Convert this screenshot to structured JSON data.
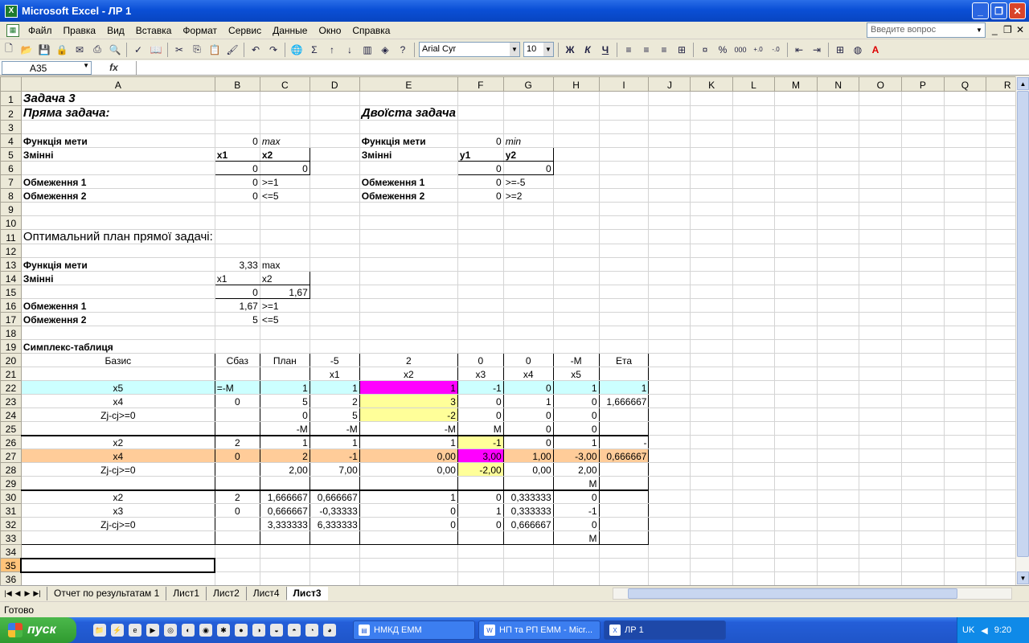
{
  "window": {
    "title": "Microsoft Excel - ЛР 1",
    "app_icon": "X"
  },
  "menu": {
    "items": [
      "Файл",
      "Правка",
      "Вид",
      "Вставка",
      "Формат",
      "Сервис",
      "Данные",
      "Окно",
      "Справка"
    ],
    "help_placeholder": "Введите вопрос"
  },
  "toolbar": {
    "font": "Arial Cyr",
    "size": "10",
    "bold": "Ж",
    "italic": "К",
    "underline": "Ч",
    "percent": "%",
    "thousands": "000"
  },
  "formula": {
    "namebox": "A35",
    "fx": "fx",
    "content": ""
  },
  "columns": [
    "A",
    "B",
    "C",
    "D",
    "E",
    "F",
    "G",
    "H",
    "I",
    "J",
    "K",
    "L",
    "M",
    "N",
    "O",
    "P",
    "Q",
    "R"
  ],
  "cells": {
    "A1": "Задача 3",
    "A2": "Пряма задача:",
    "E2": "Двоїста задача",
    "A4": "Функція мети",
    "B4": "0",
    "C4": "max",
    "E4": "Функція мети",
    "F4": "0",
    "G4": "min",
    "A5": "Змінні",
    "B5": "x1",
    "C5": "x2",
    "E5": "Змінні",
    "F5": "y1",
    "G5": "y2",
    "B6": "0",
    "C6": "0",
    "F6": "0",
    "G6": "0",
    "A7": "Обмеження 1",
    "B7": "0",
    "C7": ">=1",
    "E7": "Обмеження 1",
    "F7": "0",
    "G7": ">=-5",
    "A8": "Обмеження 2",
    "B8": "0",
    "C8": "<=5",
    "E8": "Обмеження 2",
    "F8": "0",
    "G8": ">=2",
    "A11": "Оптимальний план прямої задачі:",
    "A13": "Функція мети",
    "B13": "3,33",
    "C13": "max",
    "A14": "Змінні",
    "B14": "x1",
    "C14": "x2",
    "B15": "0",
    "C15": "1,67",
    "A16": "Обмеження 1",
    "B16": "1,67",
    "C16": ">=1",
    "A17": "Обмеження 2",
    "B17": "5",
    "C17": "<=5",
    "A19": "Симплекс-таблиця",
    "A20": "Базис",
    "B20": "Сбаз",
    "C20": "План",
    "D20": "-5",
    "E20": "2",
    "F20": "0",
    "G20": "0",
    "H20": "-M",
    "I20": "Ета",
    "D21": "x1",
    "E21": "x2",
    "F21": "x3",
    "G21": "x4",
    "H21": "x5",
    "A22": "x5",
    "B22": "=-M",
    "C22": "1",
    "D22": "1",
    "E22": "1",
    "F22": "-1",
    "G22": "0",
    "H22": "1",
    "I22": "1",
    "A23": "x4",
    "B23": "0",
    "C23": "5",
    "D23": "2",
    "E23": "3",
    "F23": "0",
    "G23": "1",
    "H23": "0",
    "I23": "1,666667",
    "A24": "Zj-cj>=0",
    "C24": "0",
    "D24": "5",
    "E24": "-2",
    "F24": "0",
    "G24": "0",
    "H24": "0",
    "C25": "-M",
    "D25": "-M",
    "E25": "-M",
    "F25": "M",
    "G25": "0",
    "H25": "0",
    "A26": "x2",
    "B26": "2",
    "C26": "1",
    "D26": "1",
    "E26": "1",
    "F26": "-1",
    "G26": "0",
    "H26": "1",
    "I26": "-",
    "A27": "x4",
    "B27": "0",
    "C27": "2",
    "D27": "-1",
    "E27": "0,00",
    "F27": "3,00",
    "G27": "1,00",
    "H27": "-3,00",
    "I27": "0,666667",
    "A28": "Zj-cj>=0",
    "C28": "2,00",
    "D28": "7,00",
    "E28": "0,00",
    "F28": "-2,00",
    "G28": "0,00",
    "H28": "2,00",
    "H29": "M",
    "A30": "x2",
    "B30": "2",
    "C30": "1,666667",
    "D30": "0,666667",
    "E30": "1",
    "F30": "0",
    "G30": "0,333333",
    "H30": "0",
    "A31": "x3",
    "B31": "0",
    "C31": "0,666667",
    "D31": "-0,33333",
    "E31": "0",
    "F31": "1",
    "G31": "0,333333",
    "H31": "-1",
    "A32": "Zj-cj>=0",
    "C32": "3,333333",
    "D32": "6,333333",
    "E32": "0",
    "F32": "0",
    "G32": "0,666667",
    "H32": "0",
    "H33": "M"
  },
  "sheets": [
    "Отчет по результатам 1",
    "Лист1",
    "Лист2",
    "Лист4",
    "Лист3"
  ],
  "active_sheet": "Лист3",
  "status": "Готово",
  "taskbar": {
    "start": "пуск",
    "tasks": [
      "НМКД ЕММ",
      "НП та РП ЕММ - Micr...",
      "ЛР 1"
    ],
    "lang": "UK",
    "time": "9:20"
  }
}
